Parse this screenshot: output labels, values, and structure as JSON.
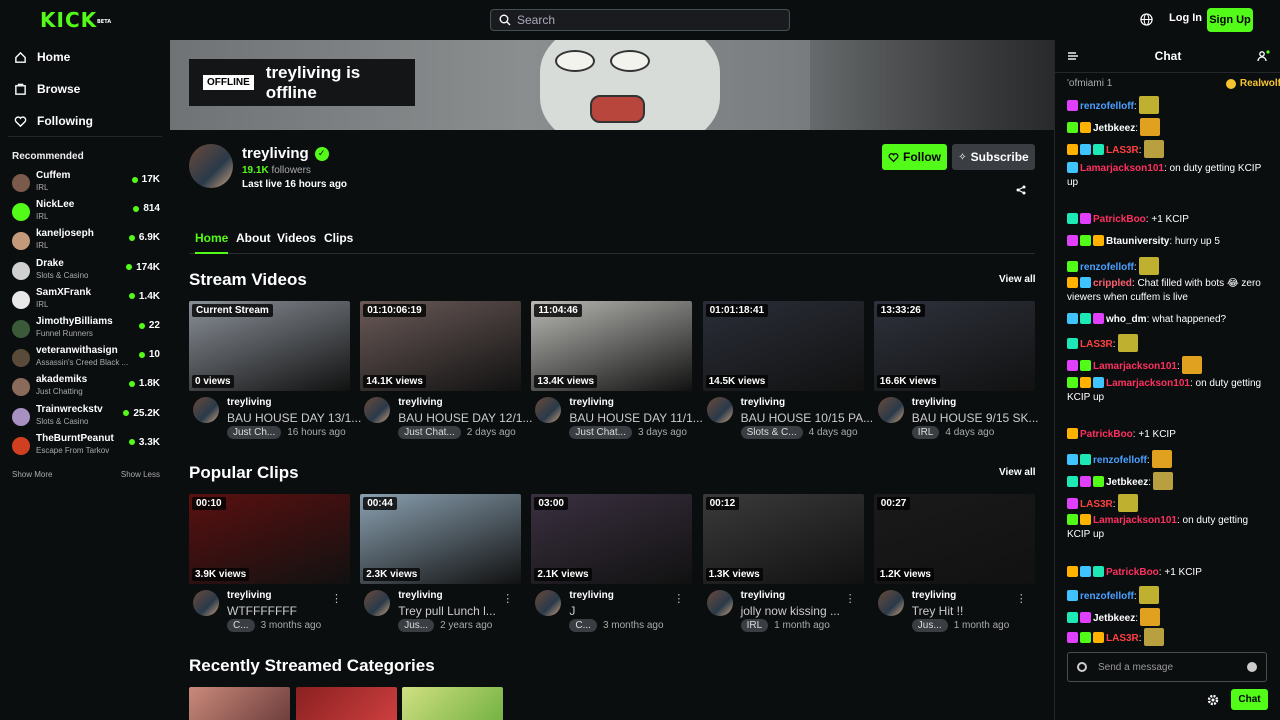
{
  "topbar": {
    "logo": "KICK",
    "logo_badge": "BETA",
    "search_placeholder": "Search",
    "login": "Log In",
    "signup": "Sign Up"
  },
  "sidebar": {
    "nav": [
      {
        "label": "Home",
        "icon": "home-icon"
      },
      {
        "label": "Browse",
        "icon": "browse-icon"
      },
      {
        "label": "Following",
        "icon": "heart-icon"
      }
    ],
    "recommended_title": "Recommended",
    "recommended": [
      {
        "name": "Cuffem",
        "category": "IRL",
        "viewers": "17K",
        "color": "#7a5a4a"
      },
      {
        "name": "NickLee",
        "category": "IRL",
        "viewers": "814",
        "color": "#53fc18"
      },
      {
        "name": "kaneljoseph",
        "category": "IRL",
        "viewers": "6.9K",
        "color": "#c49a7a"
      },
      {
        "name": "Drake",
        "category": "Slots & Casino",
        "viewers": "174K",
        "color": "#d0d0d0"
      },
      {
        "name": "SamXFrank",
        "category": "IRL",
        "viewers": "1.4K",
        "color": "#e8e8e8"
      },
      {
        "name": "JimothyBilliams",
        "category": "Funnel Runners",
        "viewers": "22",
        "color": "#3a5a3a"
      },
      {
        "name": "veteranwithasign",
        "category": "Assassin's Creed Black ...",
        "viewers": "10",
        "color": "#5a4a3a"
      },
      {
        "name": "akademiks",
        "category": "Just Chatting",
        "viewers": "1.8K",
        "color": "#8a6a5a"
      },
      {
        "name": "Trainwreckstv",
        "category": "Slots & Casino",
        "viewers": "25.2K",
        "color": "#a890c0"
      },
      {
        "name": "TheBurntPeanut",
        "category": "Escape From Tarkov",
        "viewers": "3.3K",
        "color": "#d04020"
      }
    ],
    "show_more": "Show More",
    "show_less": "Show Less"
  },
  "channel": {
    "offline_tag": "OFFLINE",
    "offline_text": "treyliving is offline",
    "name": "treyliving",
    "followers_count": "19.1K",
    "followers_label": "followers",
    "last_live": "Last live 16 hours ago",
    "follow": "Follow",
    "subscribe": "Subscribe",
    "tabs": [
      "Home",
      "About",
      "Videos",
      "Clips"
    ]
  },
  "stream_videos": {
    "title": "Stream Videos",
    "view_all": "View all",
    "items": [
      {
        "tag": "Current Stream",
        "views": "0 views",
        "channel": "treyliving",
        "title": "BAU HOUSE DAY 13/1...",
        "category": "Just Ch...",
        "age": "16 hours ago",
        "bg": "#8a9098"
      },
      {
        "tag": "01:10:06:19",
        "views": "14.1K views",
        "channel": "treyliving",
        "title": "BAU HOUSE DAY 12/1...",
        "category": "Just Chat...",
        "age": "2 days ago",
        "bg": "#6a5a58"
      },
      {
        "tag": "11:04:46",
        "views": "13.4K views",
        "channel": "treyliving",
        "title": "BAU HOUSE DAY 11/1...",
        "category": "Just Chat...",
        "age": "3 days ago",
        "bg": "#b8b8b4"
      },
      {
        "tag": "01:01:18:41",
        "views": "14.5K views",
        "channel": "treyliving",
        "title": "BAU HOUSE 10/15 PA...",
        "category": "Slots & C...",
        "age": "4 days ago",
        "bg": "#2a2e38"
      },
      {
        "tag": "13:33:26",
        "views": "16.6K views",
        "channel": "treyliving",
        "title": "BAU HOUSE 9/15 SK...",
        "category": "IRL",
        "age": "4 days ago",
        "bg": "#2e323c"
      }
    ]
  },
  "popular_clips": {
    "title": "Popular Clips",
    "view_all": "View all",
    "items": [
      {
        "tag": "00:10",
        "views": "3.9K views",
        "channel": "treyliving",
        "title": "WTFFFFFFF",
        "category": "C...",
        "age": "3 months ago",
        "bg": "#5a1010"
      },
      {
        "tag": "00:44",
        "views": "2.3K views",
        "channel": "treyliving",
        "title": "Trey pull Lunch l...",
        "category": "Jus...",
        "age": "2 years ago",
        "bg": "#8aa0b0"
      },
      {
        "tag": "03:00",
        "views": "2.1K views",
        "channel": "treyliving",
        "title": "J",
        "category": "C...",
        "age": "3 months ago",
        "bg": "#3a3040"
      },
      {
        "tag": "00:12",
        "views": "1.3K views",
        "channel": "treyliving",
        "title": "jolly now kissing ...",
        "category": "IRL",
        "age": "1 month ago",
        "bg": "#3a3a3a"
      },
      {
        "tag": "00:27",
        "views": "1.2K views",
        "channel": "treyliving",
        "title": "Trey Hit !!",
        "category": "Jus...",
        "age": "1 month ago",
        "bg": "#1a1a1a"
      }
    ]
  },
  "categories": {
    "title": "Recently Streamed Categories"
  },
  "chat": {
    "title": "Chat",
    "pinned_left": "'ofmiami 1",
    "pinned_right": "Realwolf",
    "messages": [
      {
        "user": "renzofelloff",
        "color": "#4aa0ff",
        "text": ":",
        "emote": true
      },
      {
        "user": "Jetbkeez",
        "color": "#ffffff",
        "text": ":",
        "emote": true
      },
      {
        "user": "LAS3R",
        "color": "#ff4040",
        "text": ":",
        "emote": true
      },
      {
        "user": "Lamarjackson101",
        "color": "#ff3060",
        "text": ": on duty getting KCIP up",
        "emote": false
      },
      {
        "user": "PatrickBoo",
        "color": "#ff3060",
        "text": ": +1 KCIP",
        "emote": false
      },
      {
        "user": "Btauniversity",
        "color": "#ffffff",
        "text": ": hurry up 5",
        "emote": false
      },
      {
        "user": "renzofelloff",
        "color": "#4aa0ff",
        "text": ":",
        "emote": true
      },
      {
        "user": "crippled",
        "color": "#ff6070",
        "text": ": Chat filled with bots 😂 zero viewers when cuffem is live",
        "emote": false
      },
      {
        "user": "who_dm",
        "color": "#ffffff",
        "text": ": what happened?",
        "emote": false
      },
      {
        "user": "LAS3R",
        "color": "#ff4040",
        "text": ":",
        "emote": true
      },
      {
        "user": "Lamarjackson101",
        "color": "#ff3060",
        "text": ":",
        "emote": true
      },
      {
        "user": "Lamarjackson101",
        "color": "#ff3060",
        "text": ": on duty getting KCIP up",
        "emote": false
      },
      {
        "user": "PatrickBoo",
        "color": "#ff3060",
        "text": ": +1 KCIP",
        "emote": false
      },
      {
        "user": "renzofelloff",
        "color": "#4aa0ff",
        "text": ":",
        "emote": true
      },
      {
        "user": "Jetbkeez",
        "color": "#ffffff",
        "text": ":",
        "emote": true
      },
      {
        "user": "LAS3R",
        "color": "#ff4040",
        "text": ":",
        "emote": true
      },
      {
        "user": "Lamarjackson101",
        "color": "#ff3060",
        "text": ": on duty getting KCIP up",
        "emote": false
      },
      {
        "user": "PatrickBoo",
        "color": "#ff3060",
        "text": ": +1 KCIP",
        "emote": false
      },
      {
        "user": "renzofelloff",
        "color": "#4aa0ff",
        "text": ":",
        "emote": true
      },
      {
        "user": "Jetbkeez",
        "color": "#ffffff",
        "text": ":",
        "emote": true
      },
      {
        "user": "LAS3R",
        "color": "#ff4040",
        "text": ":",
        "emote": true
      }
    ],
    "input_placeholder": "Send a message",
    "send": "Chat"
  },
  "colors": {
    "accent": "#53fc18",
    "background": "#0b0e0f"
  }
}
